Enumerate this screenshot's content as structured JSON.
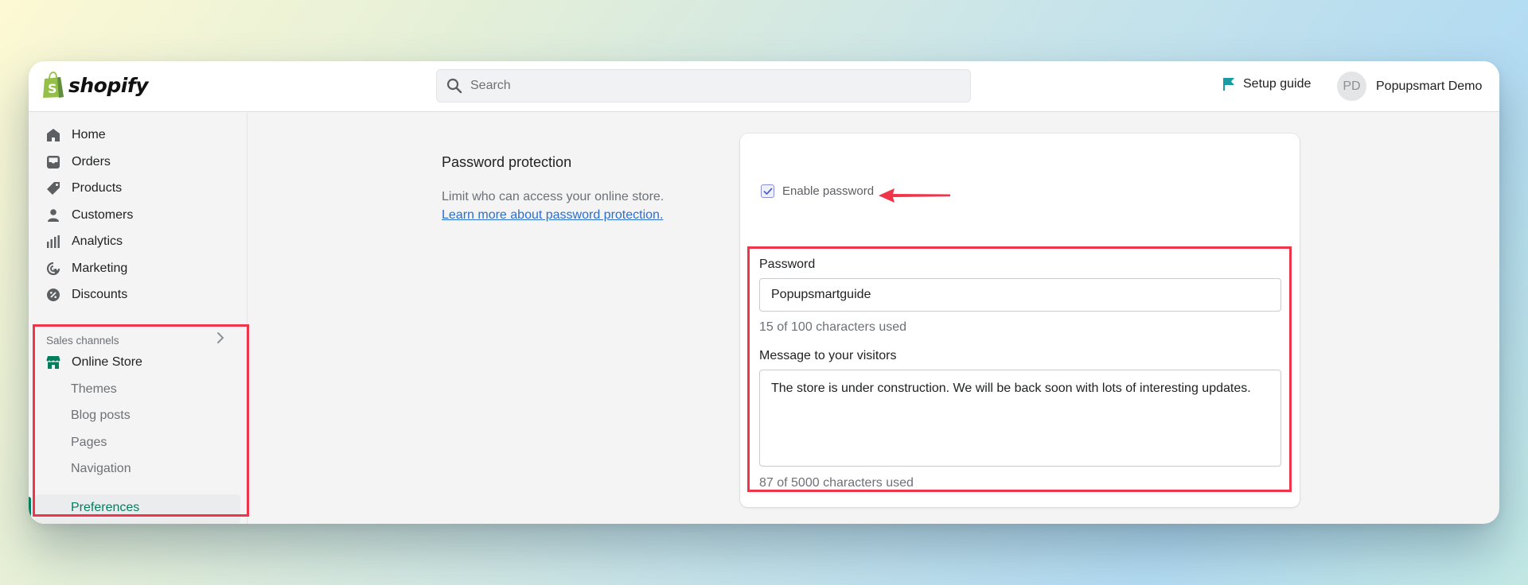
{
  "app": {
    "brand": "shopify"
  },
  "topbar": {
    "search_placeholder": "Search",
    "setup_guide_label": "Setup guide",
    "user_initials": "PD",
    "user_name": "Popupsmart Demo"
  },
  "sidebar": {
    "items": [
      {
        "label": "Home",
        "icon": "home-icon"
      },
      {
        "label": "Orders",
        "icon": "orders-icon"
      },
      {
        "label": "Products",
        "icon": "tag-icon"
      },
      {
        "label": "Customers",
        "icon": "person-icon"
      },
      {
        "label": "Analytics",
        "icon": "bar-chart-icon"
      },
      {
        "label": "Marketing",
        "icon": "target-icon"
      },
      {
        "label": "Discounts",
        "icon": "discount-icon"
      }
    ],
    "sales_channels_label": "Sales channels",
    "online_store": {
      "label": "Online Store",
      "icon": "store-icon"
    },
    "sub_items": [
      {
        "label": "Themes"
      },
      {
        "label": "Blog posts"
      },
      {
        "label": "Pages"
      },
      {
        "label": "Navigation"
      },
      {
        "label": "Preferences",
        "active": true
      }
    ]
  },
  "main": {
    "section_title": "Password protection",
    "section_description": "Limit who can access your online store.",
    "learn_more_link": "Learn more about password protection.",
    "enable_password": {
      "label": "Enable password",
      "checked": true
    },
    "password": {
      "label": "Password",
      "value": "Popupsmartguide",
      "help": "15 of 100 characters used"
    },
    "message": {
      "label": "Message to your visitors",
      "value": "The store is under construction. We will be back soon with lots of interesting updates.",
      "help": "87 of 5000 characters used"
    }
  },
  "colors": {
    "brand_green": "#95bf47",
    "active_green": "#007f5f",
    "link_blue": "#2c6ecb",
    "setup_flag": "#1a9ba1",
    "annotation_red": "#f0354b"
  }
}
